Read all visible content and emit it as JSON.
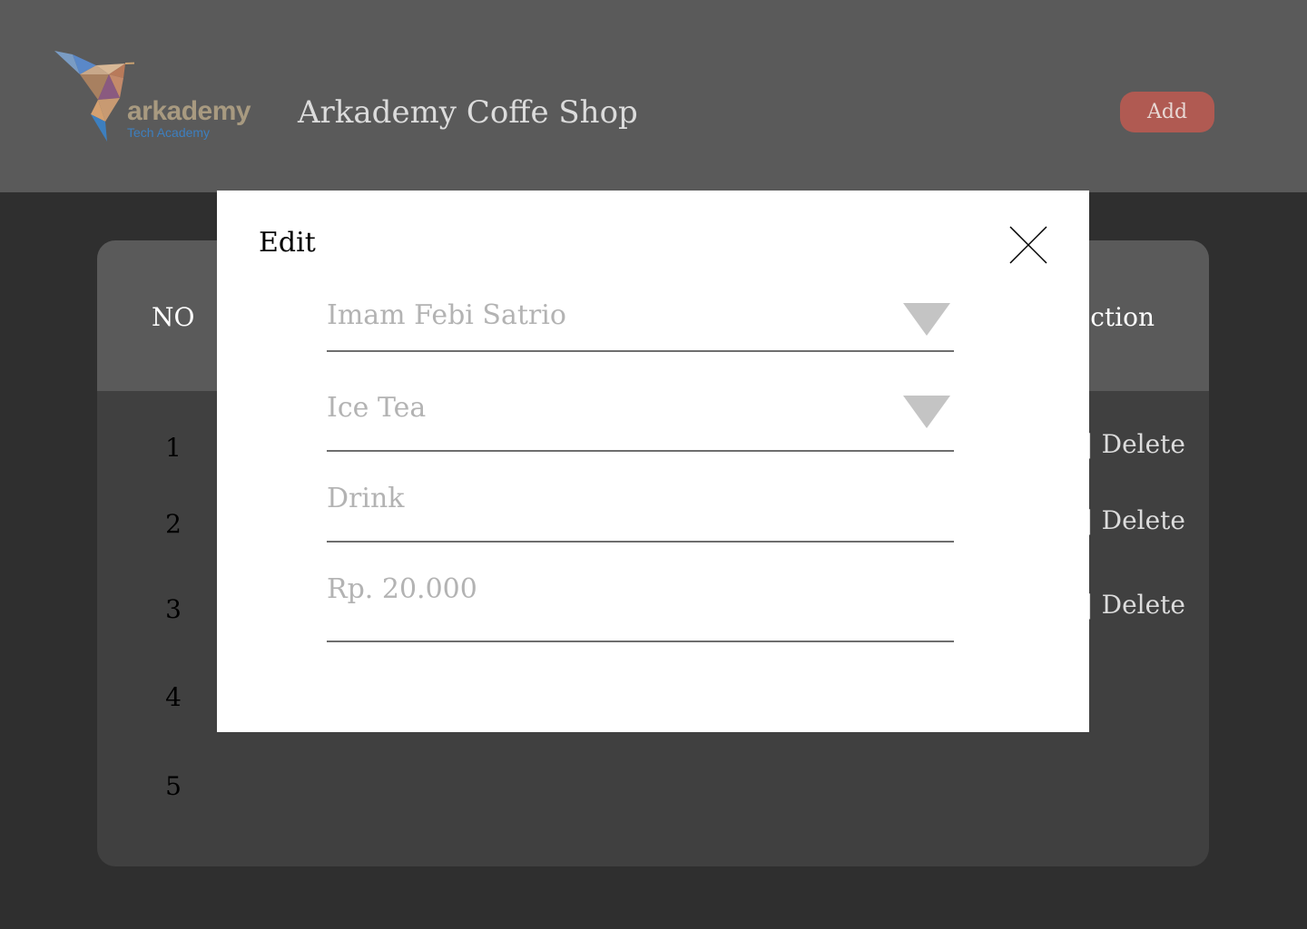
{
  "header": {
    "logo_name": "arkademy",
    "logo_tagline": "Tech Academy",
    "title": "Arkademy Coffe Shop",
    "add_label": "Add"
  },
  "table": {
    "columns": {
      "no": "NO",
      "action": "ction"
    },
    "rows": [
      {
        "no": "1",
        "action": "| Delete"
      },
      {
        "no": "2",
        "action": "| Delete"
      },
      {
        "no": "3",
        "action": "| Delete"
      },
      {
        "no": "4",
        "action": ""
      },
      {
        "no": "5",
        "action": ""
      }
    ]
  },
  "modal": {
    "title": "Edit",
    "fields": {
      "cashier": "Imam Febi Satrio",
      "product": "Ice Tea",
      "category": "Drink",
      "price": "Rp. 20.000"
    }
  },
  "colors": {
    "header": "#5a5a5a",
    "add_button": "#b05a52",
    "background": "#2f2f2f",
    "modal": "#ffffff"
  },
  "icons": [
    "hummingbird-logo",
    "close-icon",
    "dropdown-caret-icon"
  ]
}
